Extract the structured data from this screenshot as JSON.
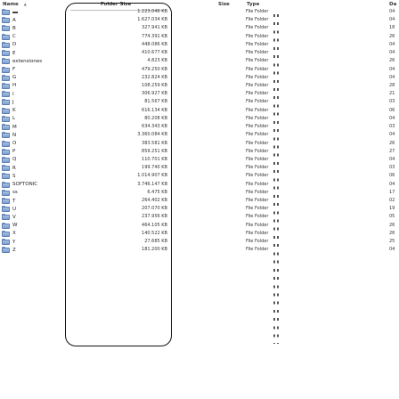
{
  "columns": {
    "name": "Name",
    "size": "Folder Size",
    "size2": "Size",
    "type": "Type",
    "date": "Da"
  },
  "rows": [
    {
      "name": "",
      "size": "1.223.046 KB",
      "type": "File Folder",
      "date": "04"
    },
    {
      "name": "A",
      "size": "1.627.034 KB",
      "type": "File Folder",
      "date": "04"
    },
    {
      "name": "B",
      "size": "327.941 KB",
      "type": "File Folder",
      "date": "18"
    },
    {
      "name": "C",
      "size": "774.391 KB",
      "type": "File Folder",
      "date": "26"
    },
    {
      "name": "D",
      "size": "448.086 KB",
      "type": "File Folder",
      "date": "04"
    },
    {
      "name": "E",
      "size": "410.677 KB",
      "type": "File Folder",
      "date": "04"
    },
    {
      "name": "extensiones",
      "size": "4.823 KB",
      "type": "File Folder",
      "date": "26"
    },
    {
      "name": "F",
      "size": "479.250 KB",
      "type": "File Folder",
      "date": "04"
    },
    {
      "name": "G",
      "size": "232.824 KB",
      "type": "File Folder",
      "date": "04"
    },
    {
      "name": "H",
      "size": "108.259 KB",
      "type": "File Folder",
      "date": "28"
    },
    {
      "name": "I",
      "size": "306.927 KB",
      "type": "File Folder",
      "date": "21"
    },
    {
      "name": "J",
      "size": "81.567 KB",
      "type": "File Folder",
      "date": "03"
    },
    {
      "name": "K",
      "size": "616.134 KB",
      "type": "File Folder",
      "date": "06"
    },
    {
      "name": "L",
      "size": "80.208 KB",
      "type": "File Folder",
      "date": "04"
    },
    {
      "name": "M",
      "size": "634.343 KB",
      "type": "File Folder",
      "date": "03"
    },
    {
      "name": "N",
      "size": "3.360.084 KB",
      "type": "File Folder",
      "date": "04"
    },
    {
      "name": "O",
      "size": "383.581 KB",
      "type": "File Folder",
      "date": "26"
    },
    {
      "name": "P",
      "size": "859.251 KB",
      "type": "File Folder",
      "date": "27"
    },
    {
      "name": "Q",
      "size": "110.701 KB",
      "type": "File Folder",
      "date": "04"
    },
    {
      "name": "R",
      "size": "199.740 KB",
      "type": "File Folder",
      "date": "03"
    },
    {
      "name": "S",
      "size": "1.014.907 KB",
      "type": "File Folder",
      "date": "06"
    },
    {
      "name": "SOFTONIC",
      "size": "3.746.147 KB",
      "type": "File Folder",
      "date": "04"
    },
    {
      "name": "ss",
      "size": "6.475 KB",
      "type": "File Folder",
      "date": "17"
    },
    {
      "name": "T",
      "size": "264.402 KB",
      "type": "File Folder",
      "date": "02"
    },
    {
      "name": "U",
      "size": "207.070 KB",
      "type": "File Folder",
      "date": "19"
    },
    {
      "name": "V",
      "size": "237.956 KB",
      "type": "File Folder",
      "date": "05"
    },
    {
      "name": "W",
      "size": "464.105 KB",
      "type": "File Folder",
      "date": "26"
    },
    {
      "name": "X",
      "size": "140.522 KB",
      "type": "File Folder",
      "date": "26"
    },
    {
      "name": "Y",
      "size": "27.685 KB",
      "type": "File Folder",
      "date": "25"
    },
    {
      "name": "Z",
      "size": "181.200 KB",
      "type": "File Folder",
      "date": "04"
    }
  ]
}
